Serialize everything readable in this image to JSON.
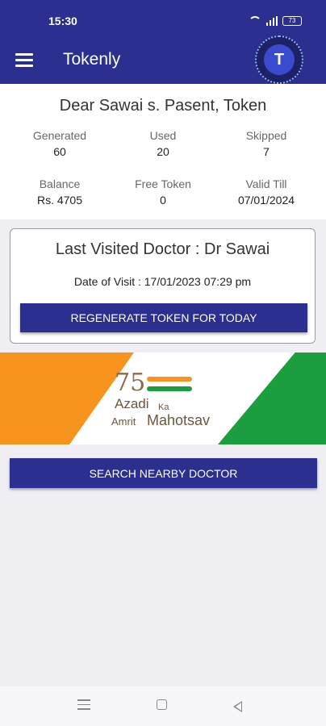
{
  "status_bar": {
    "time": "15:30",
    "battery": "73"
  },
  "app": {
    "title": "Tokenly"
  },
  "summary": {
    "greeting": "Dear Sawai s. Pasent, Token",
    "stats": [
      {
        "label": "Generated",
        "value": "60"
      },
      {
        "label": "Used",
        "value": "20"
      },
      {
        "label": "Skipped",
        "value": "7"
      },
      {
        "label": "Balance",
        "value": "Rs. 4705"
      },
      {
        "label": "Free Token",
        "value": "0"
      },
      {
        "label": "Valid Till",
        "value": "07/01/2024"
      }
    ]
  },
  "visit": {
    "doctor_line": "Last Visited Doctor : Dr Sawai",
    "date_line": "Date of Visit : 17/01/2023 07:29 pm",
    "regen_label": "REGENERATE TOKEN FOR TODAY"
  },
  "banner": {
    "number": "75",
    "azadi": "Azadi",
    "ka": "Ka",
    "amrit": "Amrit",
    "mahotsav": "Mahotsav"
  },
  "search": {
    "label": "SEARCH NEARBY DOCTOR"
  },
  "colors": {
    "primary": "#2b2f8f",
    "saffron": "#f7941d",
    "green": "#1a9e3e"
  }
}
